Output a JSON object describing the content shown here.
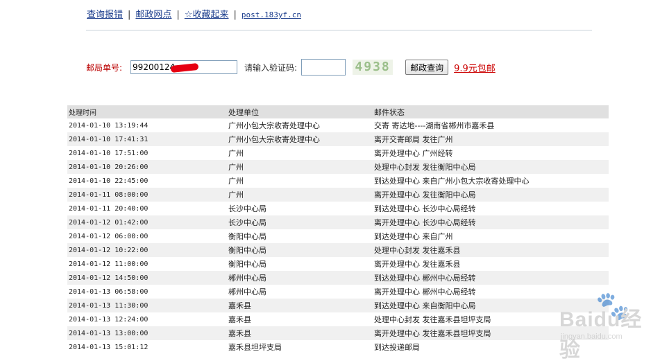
{
  "nav": {
    "link1": "查询报错",
    "link2": "邮政网点",
    "link3": "☆收藏起来",
    "site": "post.183yf.cn",
    "sep": "|"
  },
  "query": {
    "order_label": "邮局单号:",
    "order_value": "99200124",
    "captcha_label": "请输入验证码:",
    "captcha_value": "",
    "captcha_code": "4938",
    "submit_label": "邮政查询",
    "promo_label": "9.9元包邮"
  },
  "table": {
    "headers": [
      "处理时间",
      "处理单位",
      "邮件状态"
    ],
    "rows": [
      [
        "2014-01-10 13:19:44",
        "广州小包大宗收寄处理中心",
        "交寄 寄达地----湖南省郴州市嘉禾县"
      ],
      [
        "2014-01-10 17:41:31",
        "广州小包大宗收寄处理中心",
        "离开交寄邮局 发往广州"
      ],
      [
        "2014-01-10 17:51:00",
        "广州",
        "离开处理中心 广州经转"
      ],
      [
        "2014-01-10 20:26:00",
        "广州",
        "处理中心封发 发往衡阳中心局"
      ],
      [
        "2014-01-10 22:45:00",
        "广州",
        "到达处理中心 来自广州小包大宗收寄处理中心"
      ],
      [
        "2014-01-11 08:00:00",
        "广州",
        "离开处理中心 发往衡阳中心局"
      ],
      [
        "2014-01-11 20:40:00",
        "长沙中心局",
        "到达处理中心 长沙中心局经转"
      ],
      [
        "2014-01-12 01:42:00",
        "长沙中心局",
        "离开处理中心 长沙中心局经转"
      ],
      [
        "2014-01-12 06:00:00",
        "衡阳中心局",
        "到达处理中心 来自广州"
      ],
      [
        "2014-01-12 10:22:00",
        "衡阳中心局",
        "处理中心封发 发往嘉禾县"
      ],
      [
        "2014-01-12 11:00:00",
        "衡阳中心局",
        "离开处理中心 发往嘉禾县"
      ],
      [
        "2014-01-12 14:50:00",
        "郴州中心局",
        "到达处理中心 郴州中心局经转"
      ],
      [
        "2014-01-13 06:58:00",
        "郴州中心局",
        "离开处理中心 郴州中心局经转"
      ],
      [
        "2014-01-13 11:30:00",
        "嘉禾县",
        "到达处理中心 来自衡阳中心局"
      ],
      [
        "2014-01-13 12:24:00",
        "嘉禾县",
        "处理中心封发 发往嘉禾县坦坪支局"
      ],
      [
        "2014-01-13 13:00:00",
        "嘉禾县",
        "离开处理中心 发往嘉禾县坦坪支局"
      ],
      [
        "2014-01-13 15:01:12",
        "嘉禾县坦坪支局",
        "到达投递邮局"
      ]
    ]
  },
  "watermark": {
    "brand": "Baidu经验",
    "url": "jingyan.baidu.com",
    "icon": "paw-icon"
  }
}
